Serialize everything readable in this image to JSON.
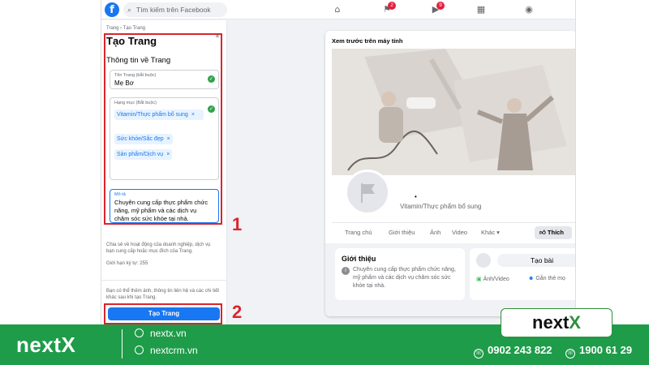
{
  "topbar": {
    "logo": "f",
    "search_placeholder": "Tìm kiếm trên Facebook",
    "badges": {
      "flag": "2",
      "video": "9"
    }
  },
  "left": {
    "breadcrumb": "Trang › Tạo Trang",
    "title": "Tạo Trang",
    "section": "Thông tin về Trang",
    "name_label": "Tên Trang (bắt buộc)",
    "name_value": "Mẹ Bơ",
    "category_label": "Hạng mục (Bắt buộc)",
    "chips": [
      "Vitamin/Thực phẩm bổ sung",
      "Sức khỏe/Sắc đẹp",
      "Sản phẩm/Dịch vụ"
    ],
    "chip_remove": "×",
    "desc_label": "Mô tả",
    "desc_value": "Chuyên cung cấp thực phẩm chức năng, mỹ phẩm và các dịch vụ chăm sóc sức khỏe tại nhà.",
    "help_text": "Chia sẻ về hoạt động của doanh nghiệp, dịch vụ bạn cung cấp hoặc mục đích của Trang.",
    "limit_text": "Giới hạn ký tự: 255",
    "more_text": "Bạn có thể thêm ảnh, thông tin liên hệ và các chi tiết khác sau khi tạo Trang.",
    "create_button": "Tạo Trang"
  },
  "annotations": {
    "one": "1",
    "two": "2"
  },
  "preview": {
    "title": "Xem trước trên máy tính",
    "category": "Vitamin/Thực phẩm bổ sung",
    "tabs": [
      "Trang chủ",
      "Giới thiệu",
      "Ảnh",
      "Video",
      "Khác ▾"
    ],
    "like_button": "Thích",
    "intro_title": "Giới thiệu",
    "intro_text": "Chuyên cung cấp thực phẩm chức năng, mỹ phẩm và các dịch vụ chăm sóc sức khỏe tại nhà.",
    "post_button": "Tạo bài",
    "post_actions": [
      "Ảnh/Video",
      "Gắn thẻ mọ"
    ]
  },
  "brand": {
    "badge_main": "next",
    "badge_x": "X",
    "footer_logo": "nextX",
    "links": [
      "nextx.vn",
      "nextcrm.vn"
    ],
    "phones": [
      "0902 243 822",
      "1900 61 29"
    ],
    "green": "#1e9c49",
    "red": "#d9262c",
    "fb_blue": "#1877f2"
  }
}
